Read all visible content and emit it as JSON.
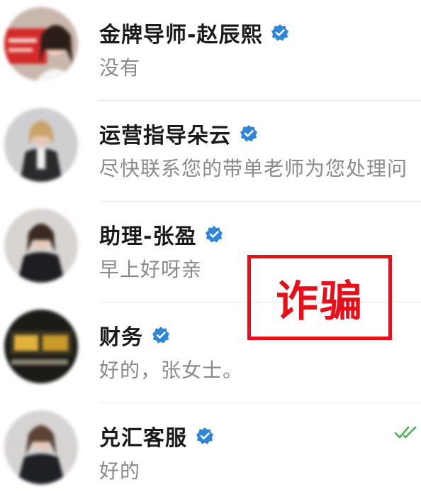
{
  "contacts": [
    {
      "name": "金牌导师-赵辰熙",
      "preview": "没有",
      "verified": true,
      "read": false
    },
    {
      "name": "运营指导朵云",
      "preview": "尽快联系您的带单老师为您处理问",
      "verified": true,
      "read": false
    },
    {
      "name": "助理-张盈",
      "preview": "早上好呀亲",
      "verified": true,
      "read": false
    },
    {
      "name": "财务",
      "preview": "好的，张女士。",
      "verified": true,
      "read": false
    },
    {
      "name": "兑汇客服",
      "preview": "好的",
      "verified": true,
      "read": true
    }
  ],
  "overlay": {
    "label": "诈骗",
    "color": "#e6101a"
  },
  "colors": {
    "verified": "#2f86d6",
    "read_check": "#4caf50"
  },
  "icons": {
    "verified": "verified-badge-icon",
    "read": "double-check-icon"
  }
}
